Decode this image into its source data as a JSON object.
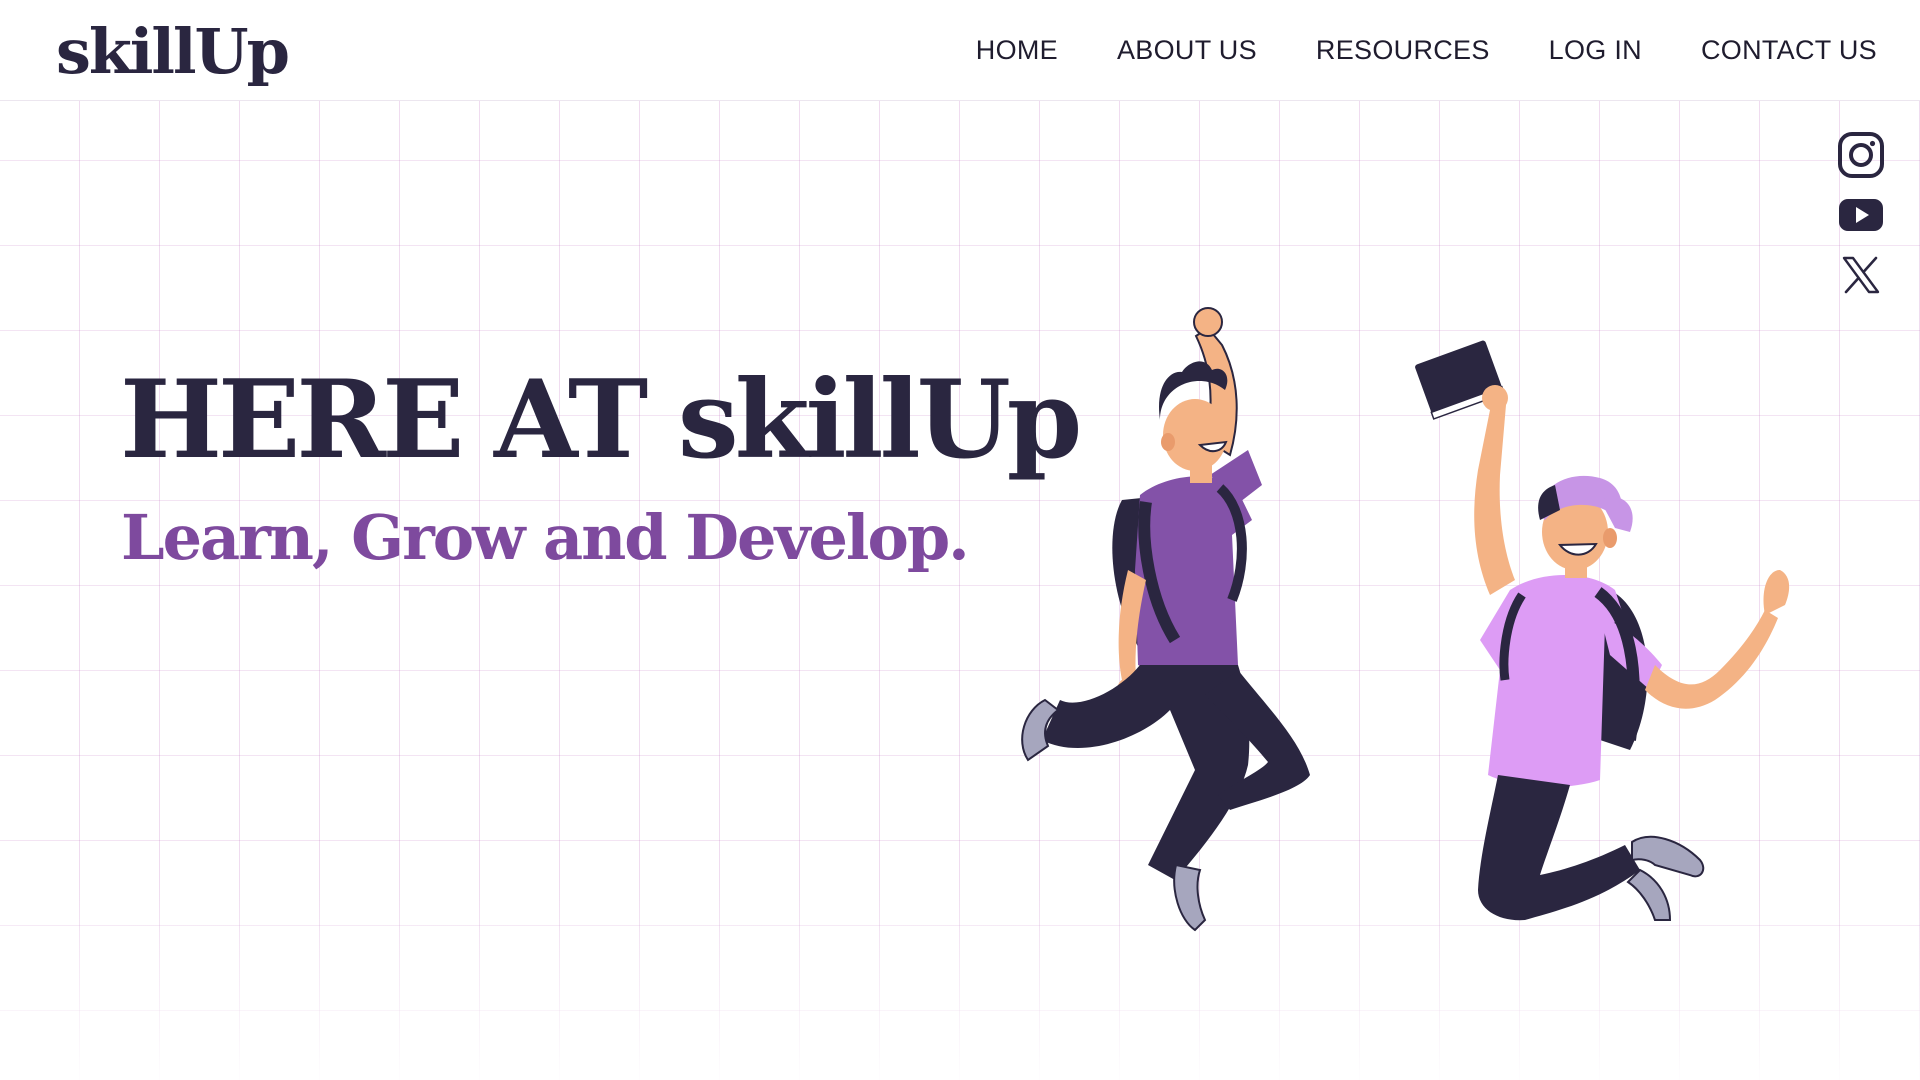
{
  "brand": {
    "logo_text": "skillUp"
  },
  "nav": {
    "items": [
      {
        "label": "HOME"
      },
      {
        "label": "ABOUT US"
      },
      {
        "label": "RESOURCES"
      },
      {
        "label": "LOG IN"
      },
      {
        "label": "CONTACT US"
      }
    ]
  },
  "social": {
    "icons": [
      "instagram-icon",
      "youtube-icon",
      "x-twitter-icon"
    ]
  },
  "hero": {
    "title": "HERE AT skillUp",
    "subtitle": "Learn, Grow and Develop."
  },
  "colors": {
    "primary_text": "#2a2640",
    "accent_purple": "#7e4a9e",
    "shirt_purple": "#8352a8",
    "shirt_lilac": "#dd9cf5",
    "grid_line": "#e3b8e3"
  }
}
